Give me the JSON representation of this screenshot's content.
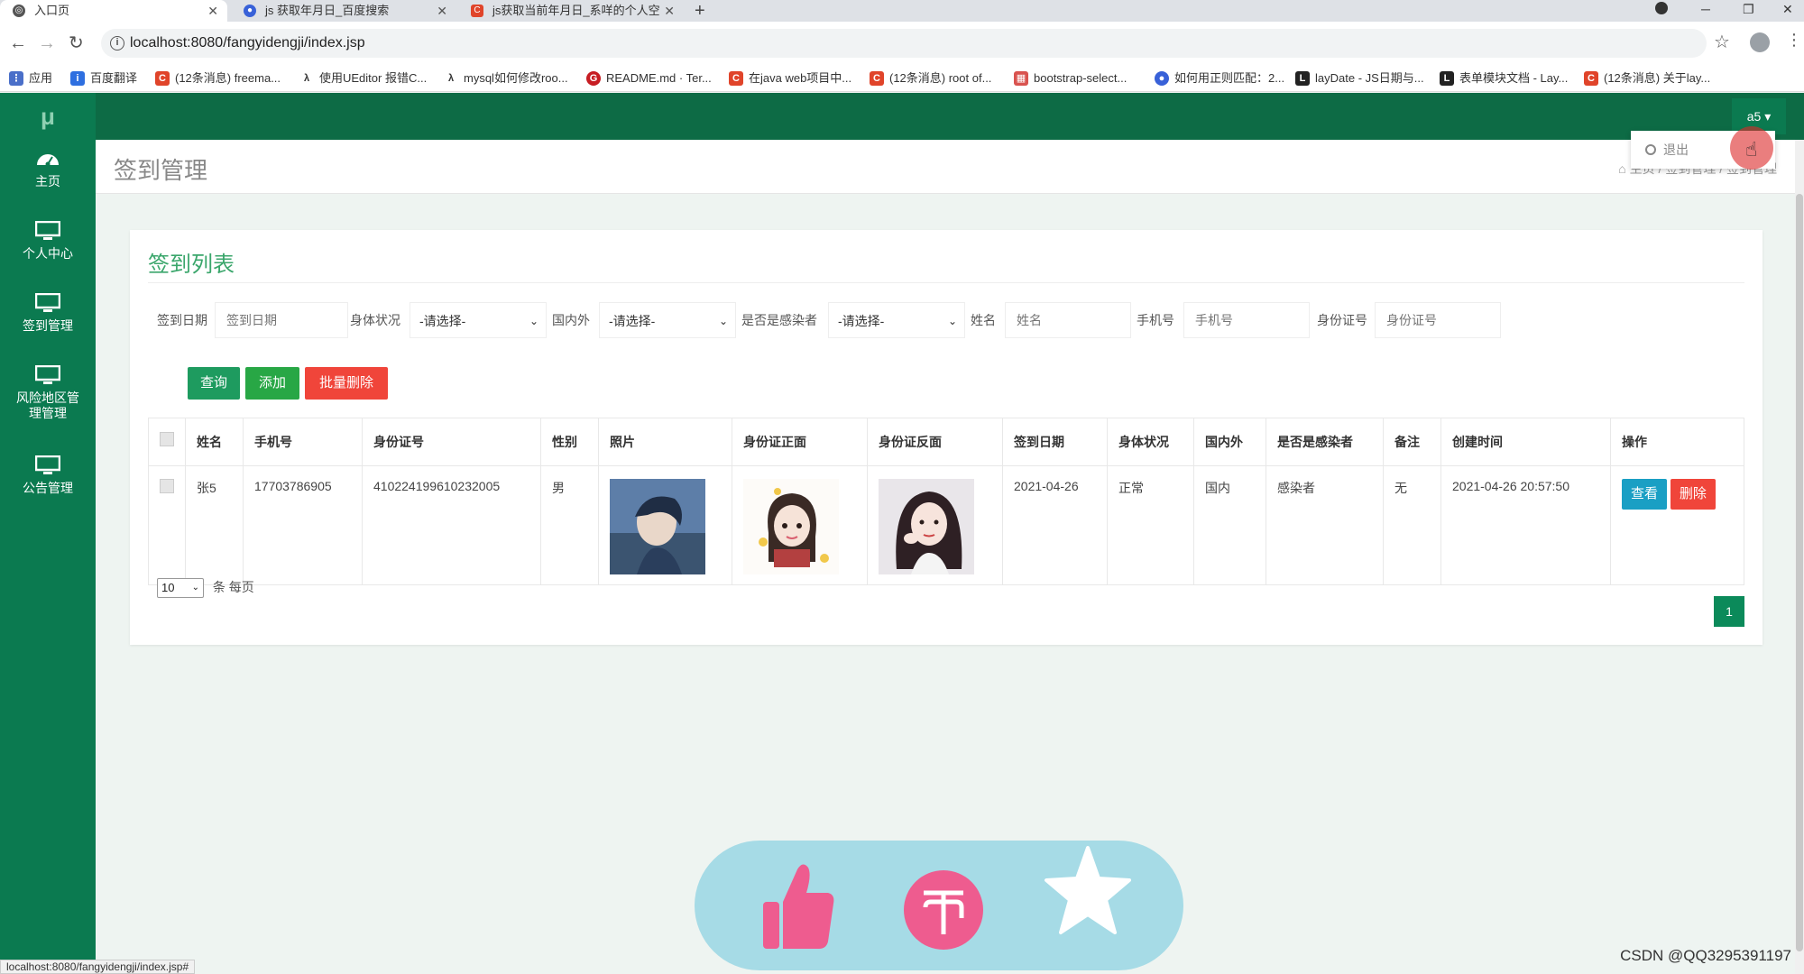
{
  "browser": {
    "tabs": [
      {
        "label": "入口页",
        "icon": "globe-icon"
      },
      {
        "label": "js 获取年月日_百度搜索",
        "icon": "baidu-paw-icon"
      },
      {
        "label": "js获取当前年月日_系咩的个人空",
        "icon": "csdn-icon"
      }
    ],
    "url": "localhost:8080/fangyidengji/index.jsp",
    "bookmarks": [
      "应用",
      "百度翻译",
      "(12条消息) freema...",
      "使用UEditor 报错C...",
      "mysql如何修改roo...",
      "README.md · Ter...",
      "在java web项目中...",
      "(12条消息) root of...",
      "bootstrap-select...",
      "如何用正则匹配：2...",
      "layDate - JS日期与...",
      "表单模块文档 - Lay...",
      "(12条消息) 关于lay..."
    ],
    "status_url": "localhost:8080/fangyidengji/index.jsp#"
  },
  "sidebar": {
    "logo": "μ",
    "items": [
      {
        "label": "主页",
        "icon": "dashboard-icon"
      },
      {
        "label": "个人中心",
        "icon": "monitor-icon"
      },
      {
        "label": "签到管理",
        "icon": "monitor-icon"
      },
      {
        "label": "风险地区管理管理",
        "icon": "monitor-icon"
      },
      {
        "label": "公告管理",
        "icon": "monitor-icon"
      }
    ]
  },
  "header": {
    "user": "a5 ▾",
    "dropdown_logout": "退出"
  },
  "page": {
    "title": "签到管理",
    "breadcrumb": "主页 / 签到管理 / 签到管理"
  },
  "card": {
    "title": "签到列表",
    "filters": {
      "date_label": "签到日期",
      "date_placeholder": "签到日期",
      "health_label": "身体状况",
      "health_value": "-请选择-",
      "region_label": "国内外",
      "region_value": "-请选择-",
      "infected_label": "是否是感染者",
      "infected_value": "-请选择-",
      "name_label": "姓名",
      "name_placeholder": "姓名",
      "phone_label": "手机号",
      "phone_placeholder": "手机号",
      "id_label": "身份证号",
      "id_placeholder": "身份证号"
    },
    "buttons": {
      "query": "查询",
      "add": "添加",
      "batch_delete": "批量删除"
    },
    "table": {
      "headers": [
        "姓名",
        "手机号",
        "身份证号",
        "性别",
        "照片",
        "身份证正面",
        "身份证反面",
        "签到日期",
        "身体状况",
        "国内外",
        "是否是感染者",
        "备注",
        "创建时间",
        "操作"
      ],
      "rows": [
        {
          "name": "张5",
          "phone": "17703786905",
          "id_number": "410224199610232005",
          "gender": "男",
          "sign_date": "2021-04-26",
          "health": "正常",
          "region": "国内",
          "infected": "感染者",
          "note": "无",
          "created": "2021-04-26 20:57:50",
          "view_label": "查看",
          "delete_label": "删除"
        }
      ]
    },
    "pager": {
      "page_size": "10",
      "per_page_text": "条 每页",
      "current_page": "1"
    }
  },
  "watermark": "CSDN @QQ3295391197",
  "colors": {
    "sidebar": "#0b7a50",
    "topbar": "#0d6b45",
    "accent_green": "#3aa66b",
    "button_green": "#1e9b5f",
    "danger": "#f0453a",
    "info": "#1a9fc4",
    "overlay": "#a6dbe6",
    "overlay_icon": "#ee5c8f"
  }
}
